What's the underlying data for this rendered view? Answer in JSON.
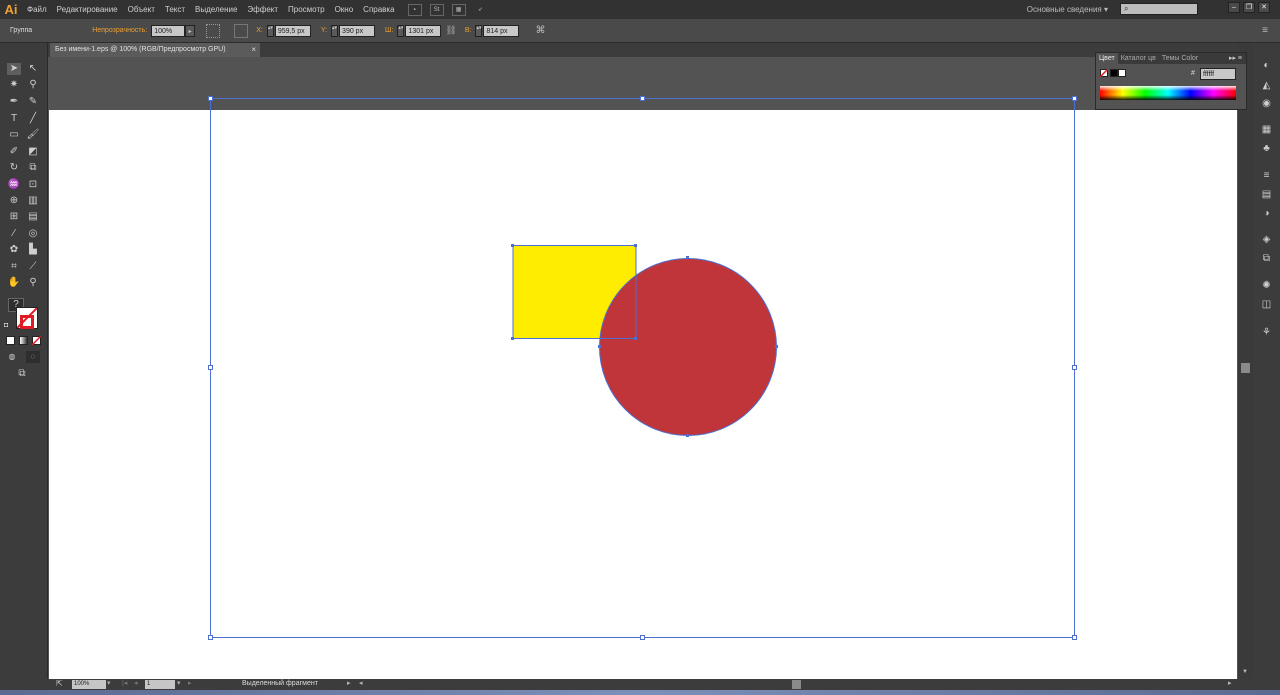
{
  "app": {
    "logo": "Ai",
    "menu": [
      "Файл",
      "Редактирование",
      "Объект",
      "Текст",
      "Выделение",
      "Эффект",
      "Просмотр",
      "Окно",
      "Справка"
    ],
    "menu_icon_st": "St",
    "workspace": "Основные сведения",
    "workspace_arrow": "▾",
    "search_icon": "⌕",
    "window_buttons": [
      "–",
      "❐",
      "✕"
    ]
  },
  "controlbar": {
    "selection_type": "Группа",
    "opacity_label": "Непрозрачность:",
    "opacity_value": "100%",
    "x_label": "X:",
    "x_value": "959,5 px",
    "y_label": "Y:",
    "y_value": "390 px",
    "w_label": "Ш:",
    "w_value": "1301 px",
    "h_label": "В:",
    "h_value": "814 px"
  },
  "document": {
    "tab_title": "Без имени-1.eps @ 100% (RGB/Предпросмотр GPU)",
    "tab_close": "×"
  },
  "color_panel": {
    "tabs": [
      "Цвет",
      "Каталог цв",
      "Темы Color"
    ],
    "hex_label": "#",
    "hex_value": "ffffff",
    "menu": "▸▸ ≡"
  },
  "artwork": {
    "rectangle_fill": "#ffed00",
    "circle_fill": "#c0353a",
    "selection_color": "#4c6fd1"
  },
  "statusbar": {
    "zoom": "100%",
    "page": "1",
    "status_text": "Выделенный фрагмент"
  }
}
